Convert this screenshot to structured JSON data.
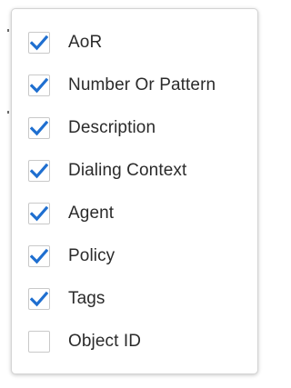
{
  "colors": {
    "check_color": "#1f6fd0",
    "text_color": "#2b2b2b",
    "border_color": "#c9c9c9"
  },
  "column_menu": {
    "options": [
      {
        "label": "AoR",
        "checked": true
      },
      {
        "label": "Number Or Pattern",
        "checked": true
      },
      {
        "label": "Description",
        "checked": true
      },
      {
        "label": "Dialing Context",
        "checked": true
      },
      {
        "label": "Agent",
        "checked": true
      },
      {
        "label": "Policy",
        "checked": true
      },
      {
        "label": "Tags",
        "checked": true
      },
      {
        "label": "Object ID",
        "checked": false
      }
    ]
  }
}
